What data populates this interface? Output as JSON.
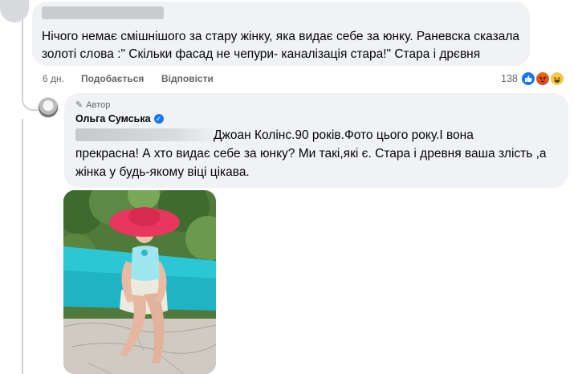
{
  "first_comment": {
    "text": "Нічого немає смішнішого за стару жінку, яка видає себе за юнку. Раневска сказала золоті слова :\" Скільки фасад не чепури- каналізація стара!\" Стара і дрєвня",
    "time": "6 дн.",
    "like_label": "Подобається",
    "reply_label": "Відповісти",
    "reaction_count": "138",
    "reactions": [
      "like-icon",
      "angry-icon",
      "haha-icon"
    ],
    "colors": {
      "like": "#1877f2",
      "angry": "#e9710f",
      "haha": "#f7c947"
    }
  },
  "reply": {
    "author_badge": "Автор",
    "author_name": "Ольга Сумська",
    "text_line1": "Джоан Колінс.90 років.Фото цього року.І вона",
    "text_rest": "прекрасна! А хто видає себе за юнку? Ми такі,які є. Стара і древня ваша злість ,а жінка у будь-якому віці цікава."
  },
  "colors": {
    "bubble": "#f0f2f5",
    "meta": "#65676b",
    "verified": "#1877f2"
  }
}
